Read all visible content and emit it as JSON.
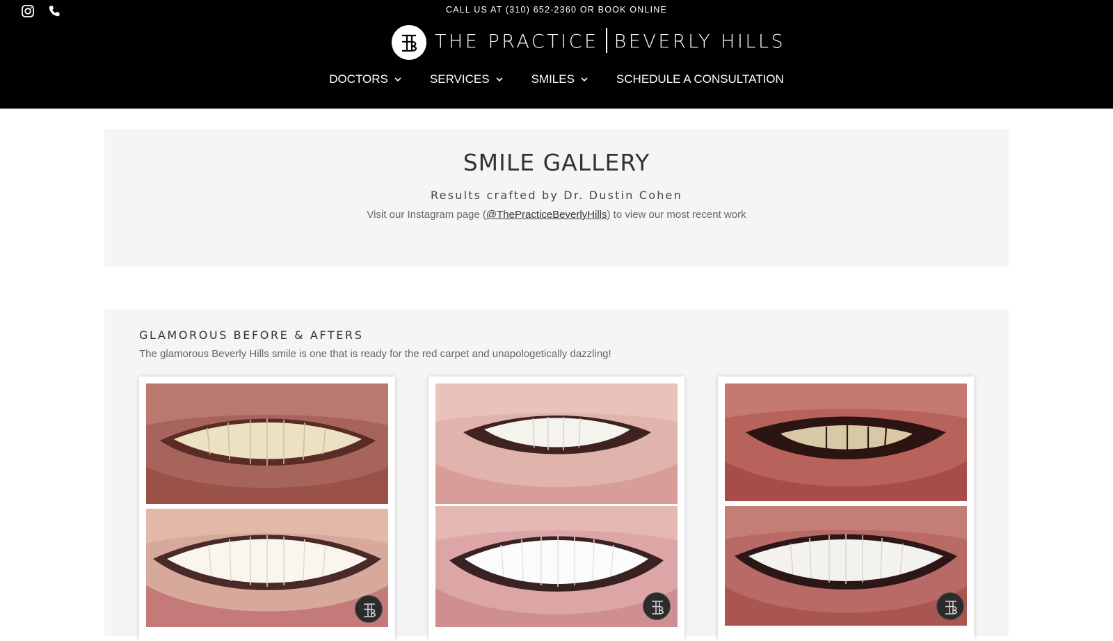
{
  "header": {
    "top_message_call": "CALL US AT (310) 652-2360",
    "top_message_or": " OR ",
    "top_message_book": "BOOK ONLINE",
    "logo_left": "THE PRACTICE",
    "logo_right": "BEVERLY HILLS",
    "social": [
      "instagram-icon",
      "phone-icon"
    ],
    "nav": [
      {
        "label": "DOCTORS",
        "has_dropdown": true
      },
      {
        "label": "SERVICES",
        "has_dropdown": true
      },
      {
        "label": "SMILES",
        "has_dropdown": true
      },
      {
        "label": "SCHEDULE A CONSULTATION",
        "has_dropdown": false
      }
    ]
  },
  "hero": {
    "title": "SMILE GALLERY",
    "subtitle": "Results crafted by Dr. Dustin Cohen",
    "text_before": "Visit our Instagram page (",
    "instagram_handle": "@ThePracticeBeverlyHills",
    "text_after": ") to view our most recent work"
  },
  "gallery": {
    "heading": "GLAMOROUS BEFORE & AFTERS",
    "description": "The glamorous Beverly Hills smile is one that is ready for the red carpet and unapologetically dazzling!",
    "cards": [
      {
        "before_alt": "before smile 1",
        "after_alt": "after smile 1"
      },
      {
        "before_alt": "before smile 2",
        "after_alt": "after smile 2"
      },
      {
        "before_alt": "before smile 3",
        "after_alt": "after smile 3"
      }
    ]
  },
  "colors": {
    "header_bg": "#000000",
    "section_bg": "#f5f5f5",
    "text_dark": "#333333"
  }
}
